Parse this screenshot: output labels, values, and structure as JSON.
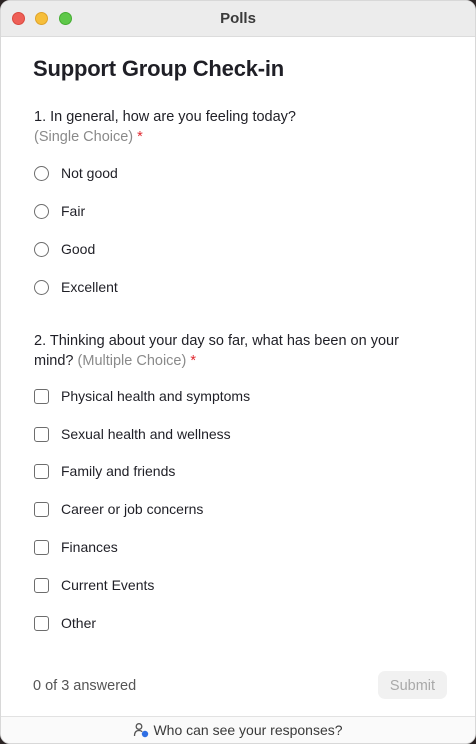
{
  "window": {
    "title": "Polls"
  },
  "page": {
    "title": "Support Group Check-in"
  },
  "questions": [
    {
      "number": "1.",
      "text": "In general, how are you feeling today?",
      "type": "(Single Choice)",
      "required": "*",
      "options": [
        "Not good",
        "Fair",
        "Good",
        "Excellent"
      ]
    },
    {
      "number": "2.",
      "text": "Thinking about your day so far, what has been on your mind?",
      "type": "(Multiple Choice)",
      "required": "*",
      "options": [
        "Physical health and symptoms",
        "Sexual health and wellness",
        "Family and friends",
        "Career or job concerns",
        "Finances",
        "Current Events",
        "Other"
      ]
    }
  ],
  "status": {
    "answered": "0 of 3 answered"
  },
  "actions": {
    "submit_label": "Submit"
  },
  "footer": {
    "privacy_label": "Who can see your responses?",
    "icon": "person-with-info-icon"
  },
  "colors": {
    "required": "#e0282f",
    "footer_icon_accent": "#2f6fe4"
  }
}
